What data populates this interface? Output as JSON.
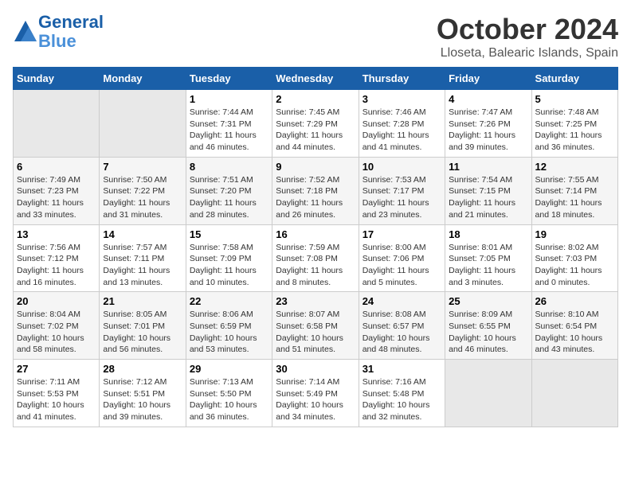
{
  "header": {
    "logo_line1": "General",
    "logo_line2": "Blue",
    "month": "October 2024",
    "location": "Lloseta, Balearic Islands, Spain"
  },
  "days_of_week": [
    "Sunday",
    "Monday",
    "Tuesday",
    "Wednesday",
    "Thursday",
    "Friday",
    "Saturday"
  ],
  "weeks": [
    [
      {
        "day": "",
        "empty": true
      },
      {
        "day": "",
        "empty": true
      },
      {
        "day": "1",
        "sunrise": "7:44 AM",
        "sunset": "7:31 PM",
        "daylight": "11 hours and 46 minutes."
      },
      {
        "day": "2",
        "sunrise": "7:45 AM",
        "sunset": "7:29 PM",
        "daylight": "11 hours and 44 minutes."
      },
      {
        "day": "3",
        "sunrise": "7:46 AM",
        "sunset": "7:28 PM",
        "daylight": "11 hours and 41 minutes."
      },
      {
        "day": "4",
        "sunrise": "7:47 AM",
        "sunset": "7:26 PM",
        "daylight": "11 hours and 39 minutes."
      },
      {
        "day": "5",
        "sunrise": "7:48 AM",
        "sunset": "7:25 PM",
        "daylight": "11 hours and 36 minutes."
      }
    ],
    [
      {
        "day": "6",
        "sunrise": "7:49 AM",
        "sunset": "7:23 PM",
        "daylight": "11 hours and 33 minutes."
      },
      {
        "day": "7",
        "sunrise": "7:50 AM",
        "sunset": "7:22 PM",
        "daylight": "11 hours and 31 minutes."
      },
      {
        "day": "8",
        "sunrise": "7:51 AM",
        "sunset": "7:20 PM",
        "daylight": "11 hours and 28 minutes."
      },
      {
        "day": "9",
        "sunrise": "7:52 AM",
        "sunset": "7:18 PM",
        "daylight": "11 hours and 26 minutes."
      },
      {
        "day": "10",
        "sunrise": "7:53 AM",
        "sunset": "7:17 PM",
        "daylight": "11 hours and 23 minutes."
      },
      {
        "day": "11",
        "sunrise": "7:54 AM",
        "sunset": "7:15 PM",
        "daylight": "11 hours and 21 minutes."
      },
      {
        "day": "12",
        "sunrise": "7:55 AM",
        "sunset": "7:14 PM",
        "daylight": "11 hours and 18 minutes."
      }
    ],
    [
      {
        "day": "13",
        "sunrise": "7:56 AM",
        "sunset": "7:12 PM",
        "daylight": "11 hours and 16 minutes."
      },
      {
        "day": "14",
        "sunrise": "7:57 AM",
        "sunset": "7:11 PM",
        "daylight": "11 hours and 13 minutes."
      },
      {
        "day": "15",
        "sunrise": "7:58 AM",
        "sunset": "7:09 PM",
        "daylight": "11 hours and 10 minutes."
      },
      {
        "day": "16",
        "sunrise": "7:59 AM",
        "sunset": "7:08 PM",
        "daylight": "11 hours and 8 minutes."
      },
      {
        "day": "17",
        "sunrise": "8:00 AM",
        "sunset": "7:06 PM",
        "daylight": "11 hours and 5 minutes."
      },
      {
        "day": "18",
        "sunrise": "8:01 AM",
        "sunset": "7:05 PM",
        "daylight": "11 hours and 3 minutes."
      },
      {
        "day": "19",
        "sunrise": "8:02 AM",
        "sunset": "7:03 PM",
        "daylight": "11 hours and 0 minutes."
      }
    ],
    [
      {
        "day": "20",
        "sunrise": "8:04 AM",
        "sunset": "7:02 PM",
        "daylight": "10 hours and 58 minutes."
      },
      {
        "day": "21",
        "sunrise": "8:05 AM",
        "sunset": "7:01 PM",
        "daylight": "10 hours and 56 minutes."
      },
      {
        "day": "22",
        "sunrise": "8:06 AM",
        "sunset": "6:59 PM",
        "daylight": "10 hours and 53 minutes."
      },
      {
        "day": "23",
        "sunrise": "8:07 AM",
        "sunset": "6:58 PM",
        "daylight": "10 hours and 51 minutes."
      },
      {
        "day": "24",
        "sunrise": "8:08 AM",
        "sunset": "6:57 PM",
        "daylight": "10 hours and 48 minutes."
      },
      {
        "day": "25",
        "sunrise": "8:09 AM",
        "sunset": "6:55 PM",
        "daylight": "10 hours and 46 minutes."
      },
      {
        "day": "26",
        "sunrise": "8:10 AM",
        "sunset": "6:54 PM",
        "daylight": "10 hours and 43 minutes."
      }
    ],
    [
      {
        "day": "27",
        "sunrise": "7:11 AM",
        "sunset": "5:53 PM",
        "daylight": "10 hours and 41 minutes."
      },
      {
        "day": "28",
        "sunrise": "7:12 AM",
        "sunset": "5:51 PM",
        "daylight": "10 hours and 39 minutes."
      },
      {
        "day": "29",
        "sunrise": "7:13 AM",
        "sunset": "5:50 PM",
        "daylight": "10 hours and 36 minutes."
      },
      {
        "day": "30",
        "sunrise": "7:14 AM",
        "sunset": "5:49 PM",
        "daylight": "10 hours and 34 minutes."
      },
      {
        "day": "31",
        "sunrise": "7:16 AM",
        "sunset": "5:48 PM",
        "daylight": "10 hours and 32 minutes."
      },
      {
        "day": "",
        "empty": true
      },
      {
        "day": "",
        "empty": true
      }
    ]
  ],
  "labels": {
    "sunrise_prefix": "Sunrise: ",
    "sunset_prefix": "Sunset: ",
    "daylight_prefix": "Daylight: "
  }
}
